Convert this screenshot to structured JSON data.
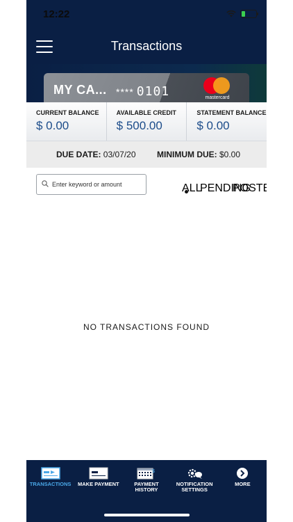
{
  "status": {
    "time": "12:22"
  },
  "header": {
    "title": "Transactions"
  },
  "card": {
    "name": "MY CA...",
    "mask": "****",
    "last4": "0101",
    "network": "mastercard"
  },
  "balances": [
    {
      "label": "CURRENT BALANCE",
      "value": "$ 0.00"
    },
    {
      "label": "AVAILABLE CREDIT",
      "value": "$ 500.00"
    },
    {
      "label": "STATEMENT BALANCE",
      "value": "$ 0.00"
    }
  ],
  "due": {
    "date_label": "DUE DATE:",
    "date_value": "03/07/20",
    "min_label": "MINIMUM DUE:",
    "min_value": "$0.00"
  },
  "search": {
    "placeholder": "Enter keyword or amount"
  },
  "filters": {
    "all": "ALL",
    "pending": "PENDING",
    "posted": "POSTED",
    "selected": "ALL"
  },
  "empty_message": "NO TRANSACTIONS FOUND",
  "nav": [
    {
      "label_line1": "TRANSACTIONS",
      "label_line2": "",
      "icon": "transactions-icon",
      "active": true
    },
    {
      "label_line1": "MAKE PAYMENT",
      "label_line2": "",
      "icon": "make-payment-icon",
      "active": false
    },
    {
      "label_line1": "PAYMENT",
      "label_line2": "HISTORY",
      "icon": "payment-history-icon",
      "active": false
    },
    {
      "label_line1": "NOTIFICATION",
      "label_line2": "SETTINGS",
      "icon": "notification-settings-icon",
      "active": false
    },
    {
      "label_line1": "MORE",
      "label_line2": "",
      "icon": "more-icon",
      "active": false
    }
  ],
  "colors": {
    "navy": "#0a1f44",
    "accent_blue": "#4aa8e8",
    "value_blue": "#1c4c8a"
  }
}
